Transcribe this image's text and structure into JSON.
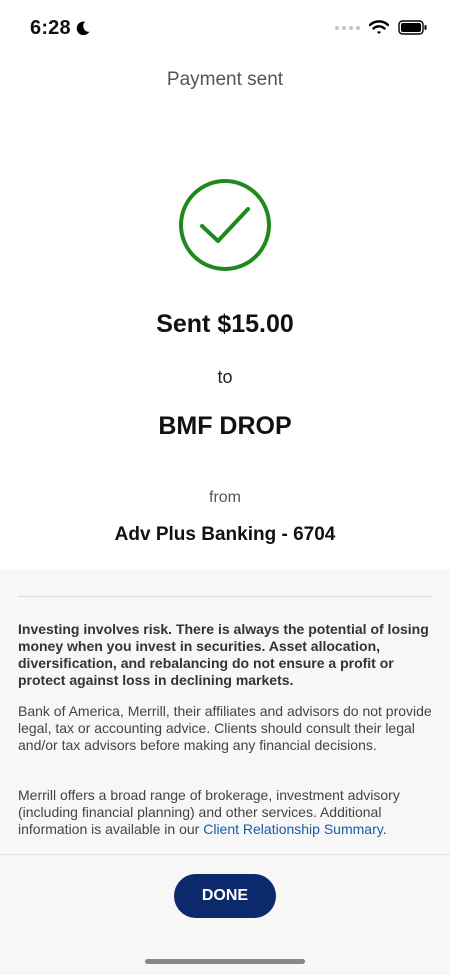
{
  "status_bar": {
    "time": "6:28"
  },
  "header": {
    "title": "Payment sent"
  },
  "confirmation": {
    "icon": "checkmark-circle-icon",
    "accent_color": "#1e8a1e",
    "amount_text": "Sent $15.00",
    "to_label": "to",
    "recipient": "BMF DROP",
    "from_label": "from",
    "account": "Adv Plus Banking - 6704"
  },
  "disclosure": {
    "risk": "Investing involves risk. There is always the potential of losing money when you invest in securities. Asset allocation, diversification, and rebalancing do not ensure a profit or protect against loss in declining markets.",
    "advice": "Bank of America, Merrill, their affiliates and advisors do not provide legal, tax or accounting advice. Clients should consult their legal and/or tax advisors before making any financial decisions.",
    "services_prefix": "Merrill offers a broad range of brokerage, investment advisory (including financial planning) and other services. Additional information is available in our ",
    "services_link": "Client Relationship Summary",
    "services_suffix": "."
  },
  "actions": {
    "done_label": "DONE",
    "button_color": "#0c2a6b"
  }
}
